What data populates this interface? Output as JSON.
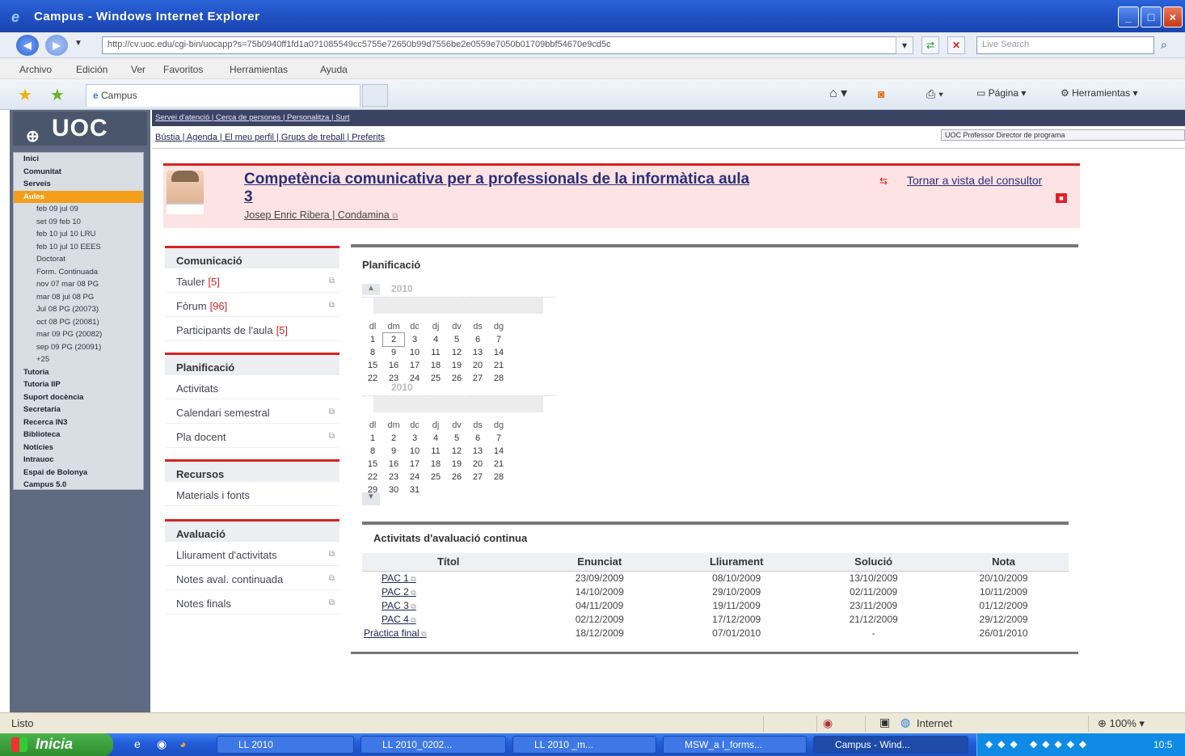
{
  "window": {
    "title": "Campus - Windows Internet Explorer",
    "url": "http://cv.uoc.edu/cgi-bin/uocapp?s=75b0940ff1fd1a0?1085549cc5755e72650b99d7556be2e0559e7050b01709bbf54670e9cd5c",
    "search_placeholder": "Live Search"
  },
  "menu": [
    "Archivo",
    "Edición",
    "Ver",
    "Favoritos",
    "Herramientas",
    "Ayuda"
  ],
  "tab_label": "Campus",
  "toolbar": {
    "pagina": "Página",
    "herramientas": "Herramientas"
  },
  "logo": "UOC",
  "topstrip": {
    "links1": "Servei d'atenció | Cerca de persones | Personalitza | Surt",
    "links2": "Bústia | Agenda | El meu perfil | Grups de treball | Preferits",
    "role": "UOC  Professor  Director de programa"
  },
  "leftnav": [
    {
      "label": "Inici",
      "type": "b"
    },
    {
      "label": "Comunitat",
      "type": "b"
    },
    {
      "label": "Serveis",
      "type": "b"
    },
    {
      "label": "Aules",
      "type": "sel"
    },
    {
      "label": "feb 09 jul 09",
      "type": "s"
    },
    {
      "label": "set 09 feb 10",
      "type": "s"
    },
    {
      "label": "feb 10 jul 10 LRU",
      "type": "s"
    },
    {
      "label": "feb 10 jul 10 EEES",
      "type": "s"
    },
    {
      "label": "Doctorat",
      "type": "s"
    },
    {
      "label": "Form. Continuada",
      "type": "s"
    },
    {
      "label": "nov 07 mar 08 PG",
      "type": "s"
    },
    {
      "label": "mar 08 jul 08 PG",
      "type": "s"
    },
    {
      "label": "Jul 08 PG (20073)",
      "type": "s"
    },
    {
      "label": "oct 08 PG (20081)",
      "type": "s"
    },
    {
      "label": "mar 09 PG (20082)",
      "type": "s"
    },
    {
      "label": "sep 09 PG (20091)",
      "type": "s"
    },
    {
      "label": "+25",
      "type": "s"
    },
    {
      "label": "Tutoria",
      "type": "b"
    },
    {
      "label": "Tutoria IIP",
      "type": "b"
    },
    {
      "label": "Suport docència",
      "type": "b"
    },
    {
      "label": "Secretaria",
      "type": "b"
    },
    {
      "label": "Recerca   IN3",
      "type": "b"
    },
    {
      "label": "Biblioteca",
      "type": "b"
    },
    {
      "label": "Notícies",
      "type": "b"
    },
    {
      "label": "Intrauoc",
      "type": "b"
    },
    {
      "label": "Espai de Bolonya",
      "type": "b"
    },
    {
      "label": "Campus 5.0",
      "type": "b"
    }
  ],
  "course": {
    "title": "Competència comunicativa per a professionals de la informàtica aula 3",
    "teacher": "Josep Enric Ribera | Condamina",
    "back_link": "Tornar a vista del consultor"
  },
  "sections": [
    {
      "title": "Comunicació",
      "items": [
        {
          "label": "Tauler",
          "count": "[5]"
        },
        {
          "label": "Fòrum",
          "count": "[96]"
        },
        {
          "label": "Participants de l'aula",
          "count": "[5]"
        }
      ]
    },
    {
      "title": "Planificació",
      "items": [
        {
          "label": "Activitats",
          "count": ""
        },
        {
          "label": "Calendari semestral",
          "count": ""
        },
        {
          "label": "Pla docent",
          "count": ""
        }
      ]
    },
    {
      "title": "Recursos",
      "items": [
        {
          "label": "Materials i fonts",
          "count": ""
        }
      ]
    },
    {
      "title": "Avaluació",
      "items": [
        {
          "label": "Lliurament d'activitats",
          "count": ""
        },
        {
          "label": "Notes aval. continuada",
          "count": ""
        },
        {
          "label": "Notes finals",
          "count": ""
        }
      ]
    }
  ],
  "planning": {
    "title": "Planificació",
    "calendars": [
      {
        "year": "2010",
        "weekdays": [
          "dl",
          "dm",
          "dc",
          "dj",
          "dv",
          "ds",
          "dg"
        ],
        "rows": [
          [
            "1",
            "2",
            "3",
            "4",
            "5",
            "6",
            "7"
          ],
          [
            "8",
            "9",
            "10",
            "11",
            "12",
            "13",
            "14"
          ],
          [
            "15",
            "16",
            "17",
            "18",
            "19",
            "20",
            "21"
          ],
          [
            "22",
            "23",
            "24",
            "25",
            "26",
            "27",
            "28"
          ]
        ]
      },
      {
        "year": "2010",
        "weekdays": [
          "dl",
          "dm",
          "dc",
          "dj",
          "dv",
          "ds",
          "dg"
        ],
        "rows": [
          [
            "1",
            "2",
            "3",
            "4",
            "5",
            "6",
            "7"
          ],
          [
            "8",
            "9",
            "10",
            "11",
            "12",
            "13",
            "14"
          ],
          [
            "15",
            "16",
            "17",
            "18",
            "19",
            "20",
            "21"
          ],
          [
            "22",
            "23",
            "24",
            "25",
            "26",
            "27",
            "28"
          ],
          [
            "29",
            "30",
            "31",
            "",
            "",
            "",
            ""
          ]
        ]
      }
    ]
  },
  "pac": {
    "title": "Activitats d'avaluació continua",
    "headers": [
      "Títol",
      "Enunciat",
      "Lliurament",
      "Solució",
      "Nota"
    ],
    "rows": [
      [
        "PAC 1",
        "23/09/2009",
        "08/10/2009",
        "13/10/2009",
        "20/10/2009"
      ],
      [
        "PAC 2",
        "14/10/2009",
        "29/10/2009",
        "02/11/2009",
        "10/11/2009"
      ],
      [
        "PAC 3",
        "04/11/2009",
        "19/11/2009",
        "23/11/2009",
        "01/12/2009"
      ],
      [
        "PAC 4",
        "02/12/2009",
        "17/12/2009",
        "21/12/2009",
        "29/12/2009"
      ],
      [
        "Pràctica final",
        "18/12/2009",
        "07/01/2010",
        "-",
        "26/01/2010"
      ]
    ]
  },
  "status": {
    "left": "Listo",
    "zone": "Internet",
    "zoom": "100%"
  },
  "taskbar": {
    "start": "Inicia",
    "tasks": [
      "LL 2010",
      "LL 2010_0202...",
      "LL 2010 _m...",
      "MSW_a I_forms...",
      "Campus - Wind..."
    ],
    "clock": "10:5"
  }
}
